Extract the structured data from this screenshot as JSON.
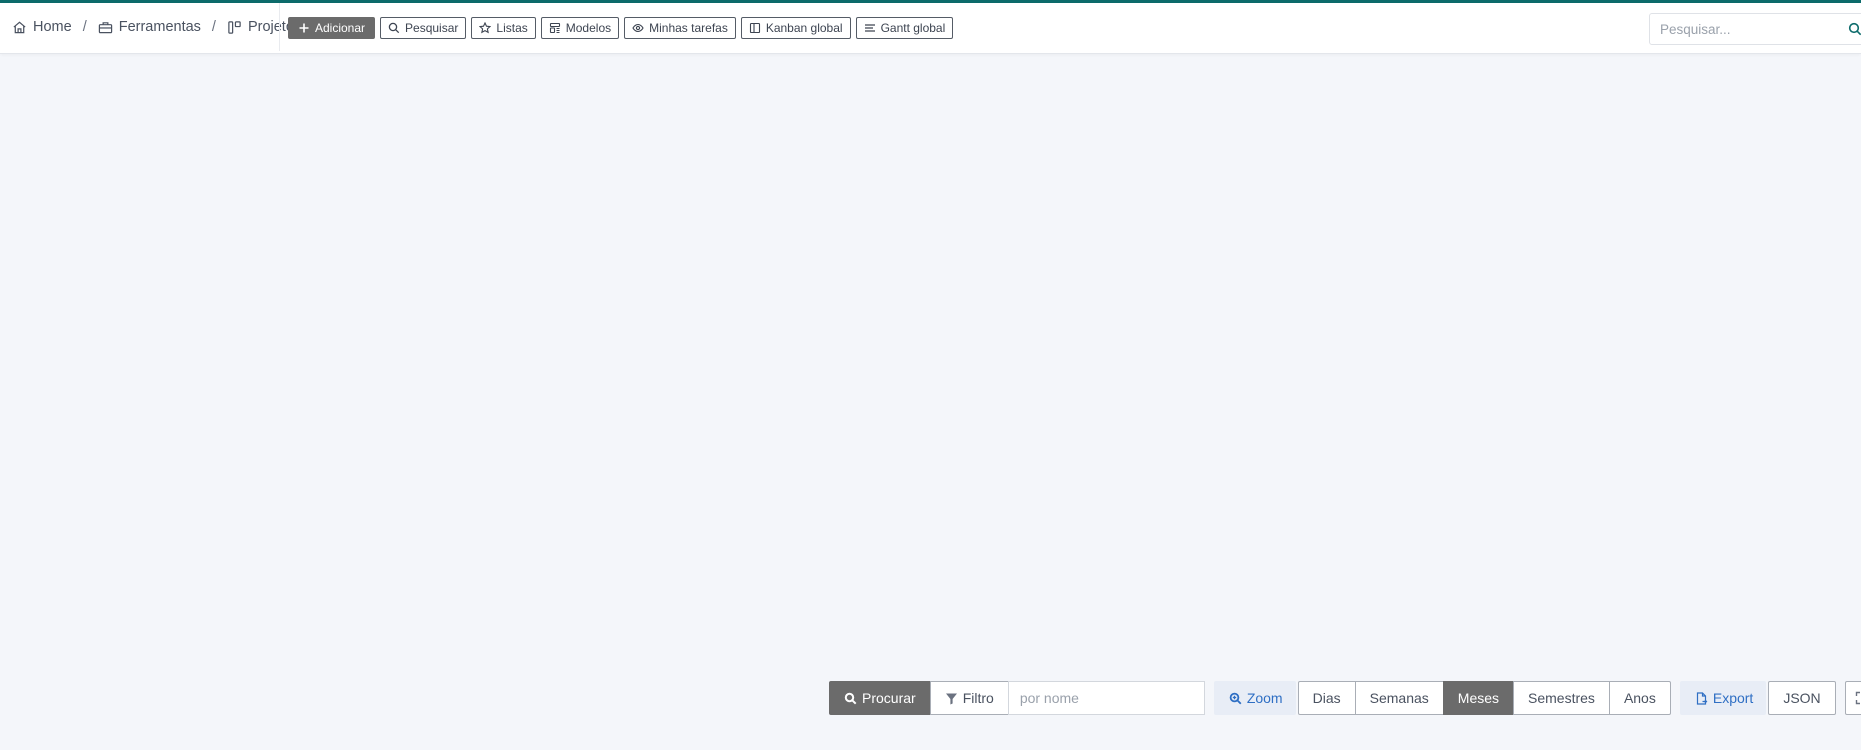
{
  "breadcrumb": {
    "home": "Home",
    "tools": "Ferramentas",
    "projects": "Projetos",
    "separator": "/"
  },
  "toolbar": {
    "add": "Adicionar",
    "search": "Pesquisar",
    "lists": "Listas",
    "templates": "Modelos",
    "my_tasks": "Minhas tarefas",
    "kanban": "Kanban global",
    "gantt": "Gantt global"
  },
  "global_search": {
    "placeholder": "Pesquisar..."
  },
  "gantt_toolbar": {
    "search_btn": "Procurar",
    "filter_btn": "Filtro",
    "name_placeholder": "por nome",
    "zoom_btn": "Zoom",
    "scales": [
      "Dias",
      "Semanas",
      "Meses",
      "Semestres",
      "Anos"
    ],
    "active_scale": "Meses",
    "export_btn": "Export",
    "json_btn": "JSON"
  },
  "colors": {
    "accent": "#0c6b6b",
    "primary_button": "#6b6b6b",
    "link_blue": "#2f6fc4",
    "background": "#f4f6fa"
  }
}
